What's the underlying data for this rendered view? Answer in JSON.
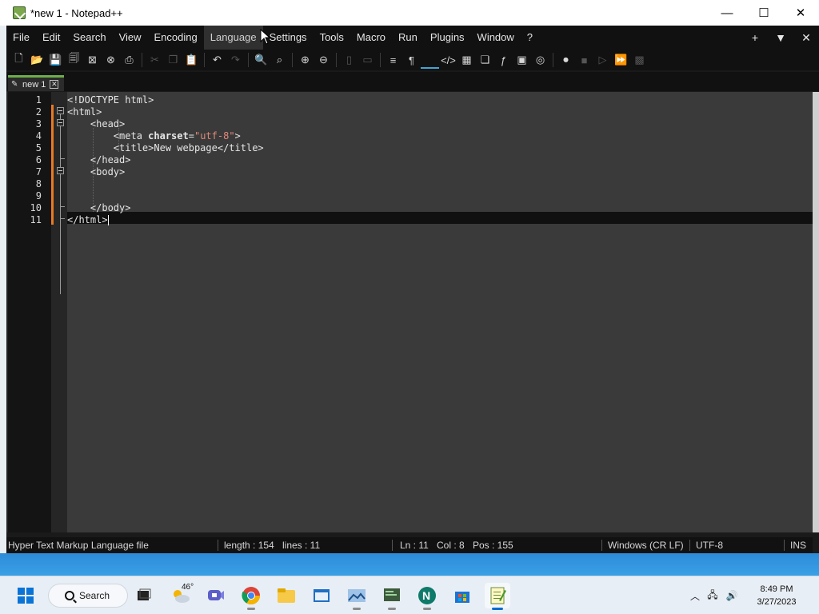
{
  "window": {
    "title": "*new 1 - Notepad++",
    "minimize": "—",
    "maximize": "☐",
    "close": "✕"
  },
  "menu": {
    "items": [
      "File",
      "Edit",
      "Search",
      "View",
      "Encoding",
      "Language",
      "Settings",
      "Tools",
      "Macro",
      "Run",
      "Plugins",
      "Window",
      "?"
    ],
    "hovered": "Language",
    "right_plus": "+",
    "right_dropdown": "▼",
    "right_close": "✕"
  },
  "toolbar": {
    "icons": [
      "new-file-icon",
      "open-file-icon",
      "save-icon",
      "save-all-icon",
      "close-icon",
      "close-all-icon",
      "print-icon",
      "cut-icon",
      "copy-icon",
      "paste-icon",
      "undo-icon",
      "redo-icon",
      "find-icon",
      "replace-icon",
      "zoom-in-icon",
      "zoom-out-icon",
      "sync-vertical-icon",
      "sync-horizontal-icon",
      "word-wrap-icon",
      "show-all-chars-icon",
      "indent-guide-icon",
      "xml-tag-icon",
      "doc-map-icon",
      "doc-list-icon",
      "function-list-icon",
      "monitoring-icon",
      "folder-workspace-icon",
      "record-macro-icon",
      "stop-macro-icon",
      "play-macro-icon",
      "run-macro-multiple-icon",
      "save-macro-icon"
    ]
  },
  "tab": {
    "label": "new 1",
    "close": "✕"
  },
  "editor": {
    "line_numbers": [
      "1",
      "2",
      "3",
      "4",
      "5",
      "6",
      "7",
      "8",
      "9",
      "10",
      "11"
    ],
    "current_line": 11,
    "lines": [
      [
        {
          "t": "tag",
          "v": "<!DOCTYPE html>"
        }
      ],
      [
        {
          "t": "tag",
          "v": "<html>"
        }
      ],
      [
        {
          "t": "txt",
          "v": "    "
        },
        {
          "t": "tag",
          "v": "<head>"
        }
      ],
      [
        {
          "t": "txt",
          "v": "        "
        },
        {
          "t": "tag",
          "v": "<meta "
        },
        {
          "t": "attr",
          "v": "charset"
        },
        {
          "t": "tag",
          "v": "="
        },
        {
          "t": "val",
          "v": "\"utf-8\""
        },
        {
          "t": "tag",
          "v": ">"
        }
      ],
      [
        {
          "t": "txt",
          "v": "        "
        },
        {
          "t": "tag",
          "v": "<title>"
        },
        {
          "t": "txt",
          "v": "New webpage"
        },
        {
          "t": "tag",
          "v": "</title>"
        }
      ],
      [
        {
          "t": "txt",
          "v": "    "
        },
        {
          "t": "tag",
          "v": "</head>"
        }
      ],
      [
        {
          "t": "txt",
          "v": "    "
        },
        {
          "t": "tag",
          "v": "<body>"
        }
      ],
      [],
      [],
      [
        {
          "t": "txt",
          "v": "    "
        },
        {
          "t": "tag",
          "v": "</body>"
        }
      ],
      [
        {
          "t": "tag",
          "v": "</html>"
        }
      ]
    ]
  },
  "status": {
    "file_type": "Hyper Text Markup Language file",
    "length": "length : 154",
    "lines": "lines : 11",
    "ln": "Ln : 11",
    "col": "Col : 8",
    "pos": "Pos : 155",
    "eol": "Windows (CR LF)",
    "encoding": "UTF-8",
    "mode": "INS"
  },
  "taskbar": {
    "search_label": "Search",
    "weather_temp": "46°",
    "time": "8:49 PM",
    "date": "3/27/2023"
  }
}
